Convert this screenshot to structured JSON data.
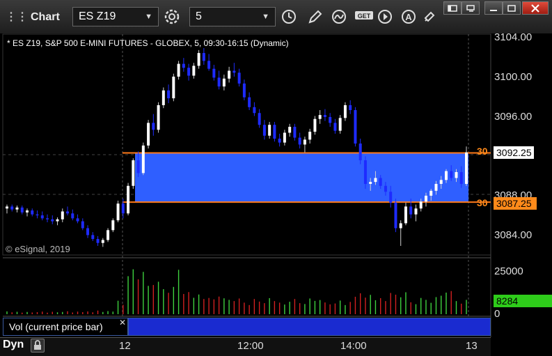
{
  "window": {
    "title": "Chart"
  },
  "toolbar": {
    "symbol": "ES Z19",
    "interval": "5"
  },
  "chart": {
    "description": "* ES Z19, S&P 500 E-MINI FUTURES - GLOBEX, 5, 09:30-16:15 (Dynamic)",
    "copyright": "© eSignal, 2019",
    "y_ticks": [
      "3104.00",
      "3100.00",
      "3096.00",
      "3088.00",
      "3084.00"
    ],
    "x_ticks": [
      "12",
      "12:00",
      "14:00",
      "13"
    ],
    "upper_level_label": "30",
    "upper_level_value": "3092.25",
    "lower_level_label": "30",
    "lower_level_value": "3087.25",
    "upper_box_price": 3092.25,
    "lower_box_price": 3087.25,
    "colors": {
      "up_bar": "#ffffff",
      "down_bar": "#1e2bff",
      "box_fill": "#2f5fff",
      "level_line": "#ff7a1a"
    }
  },
  "volume": {
    "label": "Vol (current price bar)",
    "y_ticks": [
      "25000",
      "0"
    ],
    "current_value": "8284",
    "colors": {
      "up": "#3ed13e",
      "down": "#d12020",
      "current_bg": "#2ecc1a"
    }
  },
  "status": {
    "mode": "Dyn"
  },
  "chart_data": {
    "type": "candlestick",
    "y_range": [
      3082.5,
      3104.5
    ],
    "candles": [
      [
        3086.6,
        3087.0,
        3086.1,
        3086.8
      ],
      [
        3086.8,
        3087.0,
        3086.3,
        3086.5
      ],
      [
        3086.5,
        3086.9,
        3086.2,
        3086.7
      ],
      [
        3086.7,
        3086.9,
        3086.0,
        3086.2
      ],
      [
        3086.2,
        3086.6,
        3085.8,
        3086.4
      ],
      [
        3086.4,
        3086.6,
        3085.8,
        3086.0
      ],
      [
        3086.0,
        3086.4,
        3085.6,
        3085.9
      ],
      [
        3085.9,
        3086.3,
        3085.4,
        3085.6
      ],
      [
        3085.6,
        3086.0,
        3085.2,
        3085.5
      ],
      [
        3085.5,
        3085.9,
        3085.0,
        3085.3
      ],
      [
        3085.3,
        3085.7,
        3084.9,
        3085.5
      ],
      [
        3085.5,
        3086.6,
        3085.2,
        3086.3
      ],
      [
        3086.3,
        3086.8,
        3085.9,
        3086.1
      ],
      [
        3086.1,
        3086.5,
        3085.4,
        3085.6
      ],
      [
        3085.6,
        3086.0,
        3085.1,
        3085.3
      ],
      [
        3085.3,
        3085.6,
        3084.4,
        3084.6
      ],
      [
        3084.6,
        3084.9,
        3083.6,
        3083.9
      ],
      [
        3083.9,
        3084.2,
        3083.3,
        3083.5
      ],
      [
        3083.5,
        3083.8,
        3082.8,
        3083.1
      ],
      [
        3083.1,
        3083.6,
        3082.7,
        3083.4
      ],
      [
        3083.4,
        3084.6,
        3083.2,
        3084.4
      ],
      [
        3084.4,
        3085.6,
        3084.2,
        3085.4
      ],
      [
        3085.4,
        3087.4,
        3085.2,
        3087.1
      ],
      [
        3087.1,
        3087.6,
        3085.6,
        3086.1
      ],
      [
        3086.1,
        3089.2,
        3085.9,
        3088.9
      ],
      [
        3088.9,
        3091.7,
        3088.6,
        3091.5
      ],
      [
        3091.5,
        3092.4,
        3089.8,
        3090.2
      ],
      [
        3090.2,
        3093.3,
        3090.0,
        3093.0
      ],
      [
        3093.0,
        3095.6,
        3092.7,
        3095.3
      ],
      [
        3095.3,
        3096.2,
        3094.0,
        3094.6
      ],
      [
        3094.6,
        3097.4,
        3094.3,
        3097.1
      ],
      [
        3097.1,
        3098.9,
        3096.8,
        3098.6
      ],
      [
        3098.6,
        3099.2,
        3097.3,
        3097.8
      ],
      [
        3097.8,
        3100.3,
        3097.5,
        3100.0
      ],
      [
        3100.0,
        3101.6,
        3099.7,
        3101.3
      ],
      [
        3101.3,
        3101.9,
        3100.5,
        3100.9
      ],
      [
        3100.9,
        3101.3,
        3099.6,
        3100.1
      ],
      [
        3100.1,
        3101.4,
        3099.8,
        3101.1
      ],
      [
        3101.1,
        3102.7,
        3100.8,
        3102.4
      ],
      [
        3102.4,
        3102.9,
        3101.2,
        3101.6
      ],
      [
        3101.6,
        3102.3,
        3100.6,
        3100.8
      ],
      [
        3100.8,
        3101.2,
        3099.6,
        3099.9
      ],
      [
        3099.9,
        3100.6,
        3098.7,
        3099.0
      ],
      [
        3099.0,
        3100.2,
        3098.6,
        3099.8
      ],
      [
        3099.8,
        3101.0,
        3099.4,
        3100.6
      ],
      [
        3100.6,
        3101.4,
        3100.0,
        3100.4
      ],
      [
        3100.4,
        3100.8,
        3099.0,
        3099.3
      ],
      [
        3099.3,
        3099.7,
        3097.6,
        3097.9
      ],
      [
        3097.9,
        3098.4,
        3096.6,
        3096.9
      ],
      [
        3096.9,
        3097.4,
        3096.0,
        3096.3
      ],
      [
        3096.3,
        3096.7,
        3094.8,
        3095.1
      ],
      [
        3095.1,
        3095.6,
        3093.6,
        3094.0
      ],
      [
        3094.0,
        3095.4,
        3093.7,
        3095.1
      ],
      [
        3095.1,
        3095.4,
        3093.4,
        3093.7
      ],
      [
        3093.7,
        3094.2,
        3092.9,
        3093.3
      ],
      [
        3093.3,
        3094.6,
        3093.0,
        3094.3
      ],
      [
        3094.3,
        3095.2,
        3093.9,
        3094.9
      ],
      [
        3094.9,
        3095.2,
        3093.5,
        3093.8
      ],
      [
        3093.8,
        3094.3,
        3092.7,
        3093.1
      ],
      [
        3093.1,
        3093.9,
        3092.3,
        3093.6
      ],
      [
        3093.6,
        3094.7,
        3093.2,
        3094.4
      ],
      [
        3094.4,
        3096.0,
        3094.1,
        3095.7
      ],
      [
        3095.7,
        3096.6,
        3095.2,
        3096.1
      ],
      [
        3096.1,
        3096.7,
        3095.5,
        3095.9
      ],
      [
        3095.9,
        3096.3,
        3094.9,
        3095.3
      ],
      [
        3095.3,
        3095.7,
        3094.2,
        3094.5
      ],
      [
        3094.5,
        3096.1,
        3094.2,
        3095.8
      ],
      [
        3095.8,
        3097.4,
        3095.5,
        3097.1
      ],
      [
        3097.1,
        3097.6,
        3096.2,
        3096.6
      ],
      [
        3096.6,
        3096.9,
        3092.9,
        3093.2
      ],
      [
        3093.2,
        3093.7,
        3091.1,
        3091.5
      ],
      [
        3091.5,
        3091.9,
        3088.6,
        3089.1
      ],
      [
        3089.1,
        3089.7,
        3088.4,
        3089.3
      ],
      [
        3089.3,
        3090.4,
        3089.0,
        3089.7
      ],
      [
        3089.7,
        3090.0,
        3088.6,
        3088.9
      ],
      [
        3088.9,
        3089.3,
        3087.9,
        3088.3
      ],
      [
        3088.3,
        3088.9,
        3086.7,
        3087.2
      ],
      [
        3087.2,
        3087.6,
        3084.2,
        3084.6
      ],
      [
        3084.6,
        3085.4,
        3082.8,
        3085.1
      ],
      [
        3085.1,
        3087.2,
        3084.9,
        3086.8
      ],
      [
        3086.8,
        3087.6,
        3085.6,
        3086.0
      ],
      [
        3086.0,
        3087.0,
        3085.3,
        3086.6
      ],
      [
        3086.6,
        3087.6,
        3086.3,
        3087.3
      ],
      [
        3087.3,
        3088.2,
        3086.8,
        3087.9
      ],
      [
        3087.9,
        3088.6,
        3087.4,
        3088.4
      ],
      [
        3088.4,
        3089.4,
        3088.0,
        3089.1
      ],
      [
        3089.1,
        3089.9,
        3088.6,
        3089.5
      ],
      [
        3089.5,
        3090.6,
        3089.2,
        3090.4
      ],
      [
        3090.4,
        3091.0,
        3089.4,
        3089.7
      ],
      [
        3089.7,
        3090.6,
        3089.3,
        3090.3
      ],
      [
        3090.3,
        3090.9,
        3088.7,
        3089.1
      ],
      [
        3089.1,
        3092.9,
        3088.9,
        3092.3
      ]
    ],
    "volumes": [
      1600,
      1100,
      1400,
      900,
      1300,
      1000,
      1200,
      1500,
      900,
      1400,
      1100,
      1300,
      1700,
      1000,
      1500,
      1200,
      1600,
      1100,
      2100,
      1300,
      1800,
      1500,
      7800,
      5400,
      22000,
      26000,
      20200,
      24500,
      16400,
      16900,
      18800,
      14500,
      12400,
      15800,
      25700,
      11700,
      12800,
      9500,
      11400,
      8800,
      9400,
      8600,
      10200,
      9200,
      8300,
      7600,
      9100,
      6700,
      5300,
      8800,
      7300,
      6400,
      9300,
      7600,
      6700,
      5600,
      7200,
      8800,
      6400,
      5900,
      9100,
      7700,
      8200,
      6800,
      5700,
      6200,
      7900,
      5300,
      7100,
      10100,
      12100,
      9600,
      11200,
      8100,
      9300,
      7600,
      12300,
      11300,
      9800,
      12700,
      6900,
      5800,
      9400,
      8300,
      6600,
      9900,
      10700,
      12500,
      13400,
      7600,
      6100,
      8300
    ]
  }
}
